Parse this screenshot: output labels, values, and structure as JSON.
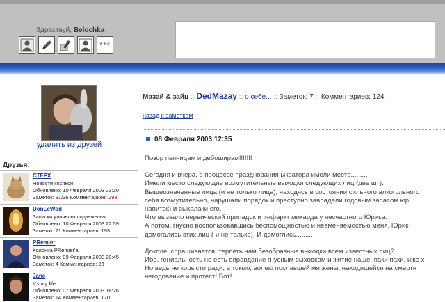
{
  "header": {
    "greeting_prefix": "Здраствуй,",
    "username": "Belochka",
    "more_label": "***"
  },
  "sidebar": {
    "remove_friend": "удалить из друзей",
    "friends_title": "Друзья:",
    "friends": [
      {
        "name": "СТЕРХ",
        "desc": "Новости косякон",
        "updated": "Обновлено: 10 Февраля 2003 23:30",
        "notes_label": "Заметок:",
        "notes_a": "31",
        "notes_b": "36",
        "comments_label": "Комментариев:",
        "comments": "293"
      },
      {
        "name": "DonLeWod",
        "desc": "Записки уличного подземелья",
        "updated": "Обновлено: 10 Февраля 2003 22:59",
        "notes_text": "Заметок: 21 Комментариев: 193"
      },
      {
        "name": "PRemier",
        "desc": "Колонка PRemier'a",
        "updated": "Обновлено: 09 Февраля 2003 20:45",
        "notes_text": "Заметок: 4 Комментариев: 23"
      },
      {
        "name": "Jane",
        "desc": "It's my life",
        "updated": "Обновлено: 07 Февраля 2003 18:26",
        "notes_text": "Заметок: 14 Комментариев: 170"
      }
    ]
  },
  "main": {
    "blog_title": "Мазай & зайц",
    "sep": "::",
    "user": "DedMazay",
    "about": "о себе...",
    "notes_count": "Заметок: 7",
    "comments_count": "Комментариев: 124",
    "back_link": "назад к заметкам",
    "post_date": "08 Февраля 2003 12:35",
    "post_lines": [
      "Позор пьяницам и дебоширам!!!!!!!",
      "",
      "Сегодня и вчера, в процессе празднования ыкватора имели место.........",
      "Имели место следующие возмутительные выходки следующих лиц (две шт).",
      "Вышеозначенные лица (и не только лица), находясь в состоянии сильного алкогольного",
      "себя возмутительно, нарушали порядок и преступно завладели годовым запасом юр",
      "напиток) и выкалаки его.",
      "Что вызвало нервический припадок и инфаркт микарда у несчастного Юрика.",
      "А потом, гнусно воспользовавшись беспомощностью и невменяемостью меня, Юрик",
      "домогались этих лиц ( и не только). И домоглись.........",
      "",
      "Доколе, спрашивается, терпеть нам безобразные выходки всем известных лиц?",
      "Ибо, гениальность не есть оправдание гнусным выходкам и житие наше, паки паки, иже х",
      "Но ведь не корысти ради, а токмо, волею пославшей мя жены, находящейся на смертн",
      "негодование и протест! Вот!"
    ]
  }
}
